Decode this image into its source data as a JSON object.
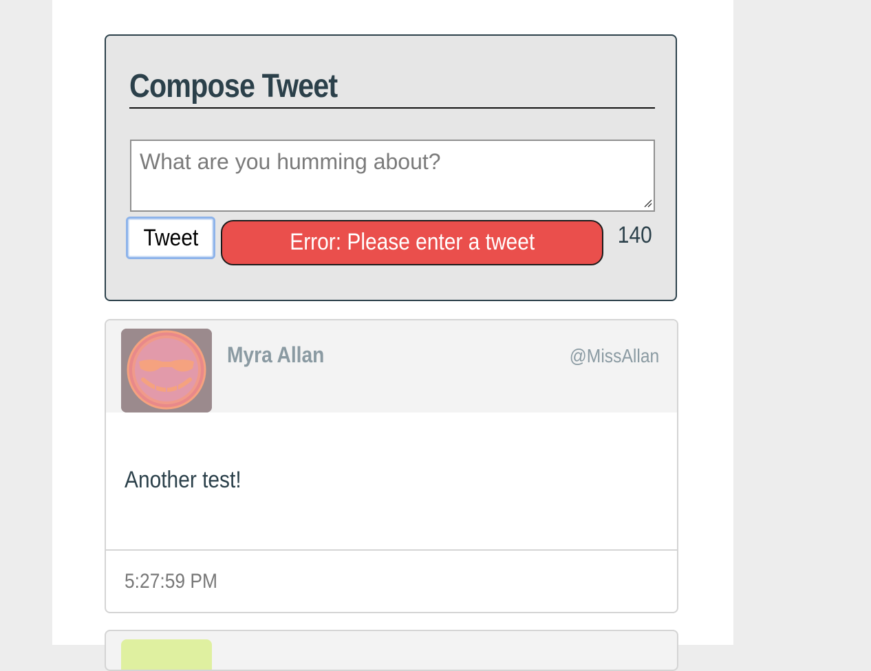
{
  "compose": {
    "title": "Compose Tweet",
    "textarea_placeholder": "What are you humming about?",
    "textarea_value": "",
    "submit_label": "Tweet",
    "error_message": "Error: Please enter a tweet",
    "char_counter": "140"
  },
  "tweets": [
    {
      "author_name": "Myra Allan",
      "handle": "@MissAllan",
      "content": "Another test!",
      "timestamp": "5:27:59 PM",
      "avatar_icon": "smiling-face-with-sunglasses-avatar"
    }
  ],
  "colors": {
    "page_background": "#ededed",
    "container_background": "#ffffff",
    "compose_background": "#e6e6e6",
    "heading_color": "#2b404a",
    "error_background": "#ea4f4c",
    "focus_ring": "#8db3ea",
    "tweet_header_background": "#f3f3f3",
    "muted_text": "#8a9aa2"
  }
}
